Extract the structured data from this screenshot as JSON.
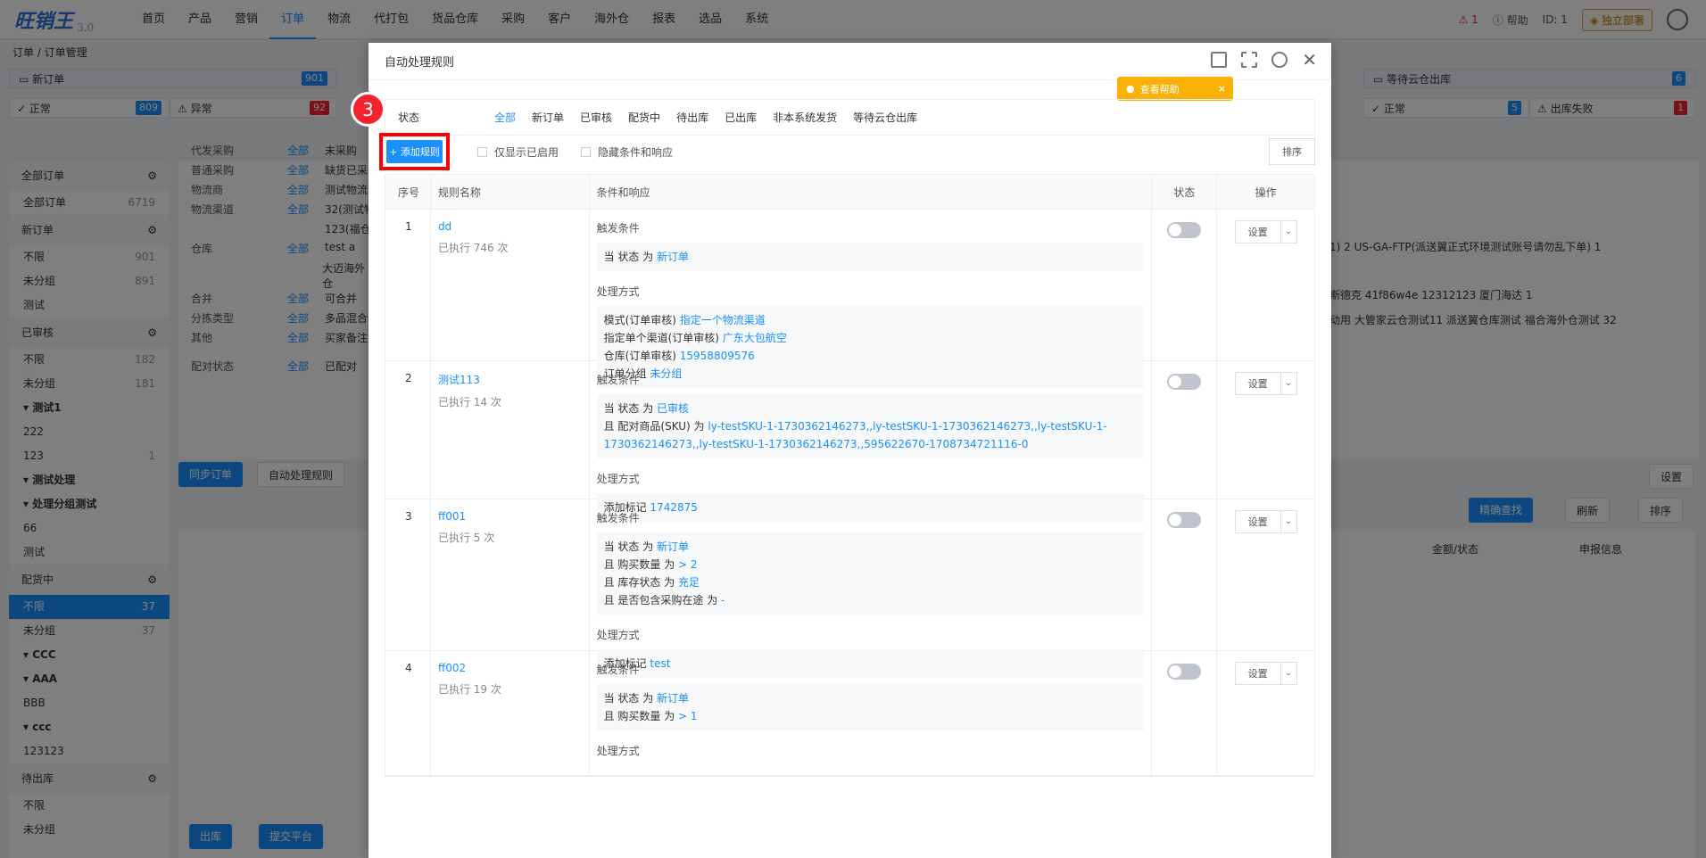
{
  "app": {
    "logo": "旺销王",
    "version": "3.0"
  },
  "nav": [
    "首页",
    "产品",
    "营销",
    "订单",
    "物流",
    "代打包",
    "货品仓库",
    "采购",
    "客户",
    "海外仓",
    "报表",
    "选品",
    "系统"
  ],
  "nav_active": "订单",
  "topright": {
    "warn": "1",
    "help": "帮助",
    "id": "ID: 1",
    "deploy": "独立部署"
  },
  "breadcrumb": "订单 / 订单管理",
  "steps": [
    {
      "label": "新订单",
      "count": "901"
    },
    {
      "label": "等待云仓出库",
      "count": "6"
    }
  ],
  "stats": [
    {
      "label": "正常",
      "count": "809"
    },
    {
      "label": "异常",
      "count": "92"
    },
    {
      "label": "正常",
      "count": "5"
    },
    {
      "label": "出库失败",
      "count": "1"
    }
  ],
  "sidebar": [
    {
      "t": "sec",
      "label": "全部订单"
    },
    {
      "t": "it",
      "label": "全部订单",
      "count": "6719"
    },
    {
      "t": "sec",
      "label": "新订单"
    },
    {
      "t": "it",
      "label": "不限",
      "count": "901"
    },
    {
      "t": "it",
      "label": "未分组",
      "count": "891"
    },
    {
      "t": "it",
      "label": "测试",
      "count": ""
    },
    {
      "t": "sec",
      "label": "已审核"
    },
    {
      "t": "it",
      "label": "不限",
      "count": "182"
    },
    {
      "t": "it",
      "label": "未分组",
      "count": "181"
    },
    {
      "t": "grp",
      "label": "▾ 测试1",
      "count": ""
    },
    {
      "t": "it",
      "label": "222",
      "count": ""
    },
    {
      "t": "it",
      "label": "123",
      "count": "1"
    },
    {
      "t": "grp",
      "label": "▾ 测试处理",
      "count": ""
    },
    {
      "t": "grp",
      "label": "▾ 处理分组测试",
      "count": ""
    },
    {
      "t": "it",
      "label": "66",
      "count": ""
    },
    {
      "t": "it",
      "label": "测试",
      "count": ""
    },
    {
      "t": "sec",
      "label": "配货中"
    },
    {
      "t": "sel",
      "label": "不限",
      "count": "37"
    },
    {
      "t": "it",
      "label": "未分组",
      "count": "37"
    },
    {
      "t": "grp",
      "label": "▾ CCC",
      "count": ""
    },
    {
      "t": "grp",
      "label": "▾ AAA",
      "count": ""
    },
    {
      "t": "it",
      "label": "BBB",
      "count": ""
    },
    {
      "t": "grp",
      "label": "▾ ccc",
      "count": ""
    },
    {
      "t": "it",
      "label": "123123",
      "count": ""
    },
    {
      "t": "sec",
      "label": "待出库"
    },
    {
      "t": "it",
      "label": "不限",
      "count": ""
    },
    {
      "t": "it",
      "label": "未分组",
      "count": ""
    }
  ],
  "filters": [
    {
      "label": "代发采购",
      "all": "全部",
      "val": "未采购"
    },
    {
      "label": "普通采购",
      "all": "全部",
      "val": "缺货已采"
    },
    {
      "label": "物流商",
      "all": "全部",
      "val": "测试物流"
    },
    {
      "label": "物流渠道",
      "all": "全部",
      "val": "32(测试物"
    },
    {
      "label": "",
      "all": "",
      "val": "123(福仓"
    },
    {
      "label": "仓库",
      "all": "全部",
      "val": "test  a"
    },
    {
      "label": "",
      "all": "",
      "val": "大迈海外仓"
    },
    {
      "label": "合并",
      "all": "全部",
      "val": "可合并"
    },
    {
      "label": "分拣类型",
      "all": "全部",
      "val": "多品混合"
    },
    {
      "label": "其他",
      "all": "全部",
      "val": "买家备注"
    },
    {
      "label": "配对状态",
      "all": "全部",
      "val": "已配对"
    }
  ],
  "buttons": {
    "sync": "同步订单",
    "auto": "自动处理规则",
    "outbound": "出库",
    "submit": "提交平台"
  },
  "bgright": {
    "r1": "1) 2   US-GA-FTP(派送翼正式环境测试账号请勿乱下单) 1",
    "r2": "斯德克   41f86w4e   12312123   厦门海达 1",
    "r3": "动用   大管家云仓测试11   派送翼仓库测试   福合海外仓测试   32",
    "settings": "设置",
    "search": "精确查找",
    "refresh": "刷新",
    "sort": "排序",
    "col_amount": "金额/状态",
    "col_decl": "申报信息"
  },
  "modal": {
    "title": "自动处理规则",
    "help": "查看帮助",
    "status_label": "状态",
    "status_tabs": [
      "全部",
      "新订单",
      "已审核",
      "配货中",
      "待出库",
      "已出库",
      "非本系统发货",
      "等待云仓出库"
    ],
    "step_badge": "3",
    "add_rule": "+ 添加规则",
    "only_enabled": "仅显示已启用",
    "hide_cond": "隐藏条件和响应",
    "sort": "排序",
    "columns": [
      "序号",
      "规则名称",
      "条件和响应",
      "状态",
      "操作"
    ],
    "trigger_label": "触发条件",
    "action_label": "处理方式",
    "set_label": "设置",
    "rules": [
      {
        "idx": "1",
        "name": "dd",
        "exec": "已执行 746 次",
        "conds": [
          [
            "当 状态 为 ",
            "新订单"
          ]
        ],
        "actions": [
          [
            "模式(订单审核) ",
            "指定一个物流渠道"
          ],
          [
            "指定单个渠道(订单审核) ",
            "广东大包航空"
          ],
          [
            "仓库(订单审核) ",
            "15958809576"
          ],
          [
            "订单分组 ",
            "未分组"
          ]
        ]
      },
      {
        "idx": "2",
        "name": "测试113",
        "exec": "已执行 14 次",
        "conds": [
          [
            "当 状态 为 ",
            "已审核"
          ],
          [
            "且 配对商品(SKU) 为 ",
            "ly-testSKU-1-1730362146273,,ly-testSKU-1-1730362146273,,ly-testSKU-1-1730362146273,,ly-testSKU-1-1730362146273,,595622670-1708734721116-0"
          ]
        ],
        "actions": [
          [
            "添加标记 ",
            "1742875"
          ]
        ]
      },
      {
        "idx": "3",
        "name": "ff001",
        "exec": "已执行 5 次",
        "conds": [
          [
            "当 状态 为 ",
            "新订单"
          ],
          [
            "且 购买数量 为 ",
            "> 2"
          ],
          [
            "且 库存状态 为 ",
            "充足"
          ],
          [
            "且 是否包含采购在途 为 ",
            "-"
          ]
        ],
        "actions": [
          [
            "添加标记 ",
            "test"
          ]
        ]
      },
      {
        "idx": "4",
        "name": "ff002",
        "exec": "已执行 19 次",
        "conds": [
          [
            "当 状态 为 ",
            "新订单"
          ],
          [
            "且 购买数量 为 ",
            "> 1"
          ]
        ],
        "actions": []
      }
    ]
  }
}
